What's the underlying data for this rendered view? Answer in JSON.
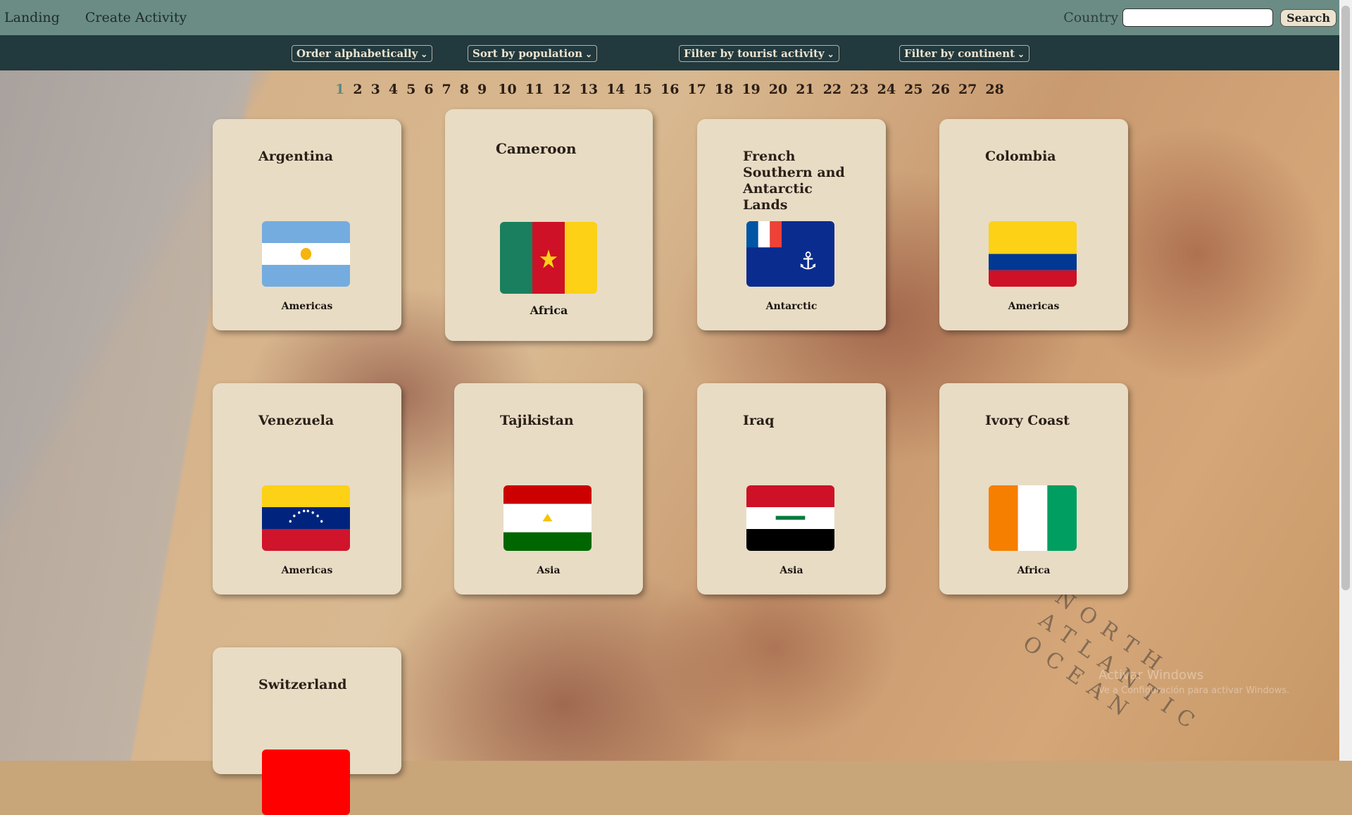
{
  "nav": {
    "landing": "Landing",
    "create_activity": "Create Activity",
    "search_label": "Country",
    "search_value": "",
    "search_button": "Search"
  },
  "filters": [
    {
      "label": "Order alphabetically"
    },
    {
      "label": "Sort by population"
    },
    {
      "label": "Filter by tourist activity"
    },
    {
      "label": "Filter by continent"
    }
  ],
  "pagination": {
    "current": 1,
    "pages": [
      "1",
      "2",
      "3",
      "4",
      "5",
      "6",
      "7",
      "8",
      "9",
      "10",
      "11",
      "12",
      "13",
      "14",
      "15",
      "16",
      "17",
      "18",
      "19",
      "20",
      "21",
      "22",
      "23",
      "24",
      "25",
      "26",
      "27",
      "28"
    ]
  },
  "countries": [
    {
      "name": "Argentina",
      "continent": "Americas",
      "flag": "argentina-flag"
    },
    {
      "name": "Cameroon",
      "continent": "Africa",
      "flag": "cameroon-flag"
    },
    {
      "name": "French Southern and Antarctic Lands",
      "continent": "Antarctic",
      "flag": "french-southern-flag"
    },
    {
      "name": "Colombia",
      "continent": "Americas",
      "flag": "colombia-flag"
    },
    {
      "name": "Venezuela",
      "continent": "Americas",
      "flag": "venezuela-flag"
    },
    {
      "name": "Tajikistan",
      "continent": "Asia",
      "flag": "tajikistan-flag"
    },
    {
      "name": "Iraq",
      "continent": "Asia",
      "flag": "iraq-flag"
    },
    {
      "name": "Ivory Coast",
      "continent": "Africa",
      "flag": "ivory-coast-flag"
    },
    {
      "name": "Switzerland",
      "continent": "",
      "flag": "switzerland-flag"
    }
  ],
  "map_text": {
    "ocean": "NORTH ATLANTIC OCEAN"
  },
  "watermark": {
    "line1": "Activar Windows",
    "line2": "Ve a Configuración para activar Windows."
  },
  "colors": {
    "topbar": "#6a8c84",
    "filterbar": "#22393d",
    "card": "#e8dcc4",
    "active_page": "#5c8a80"
  }
}
